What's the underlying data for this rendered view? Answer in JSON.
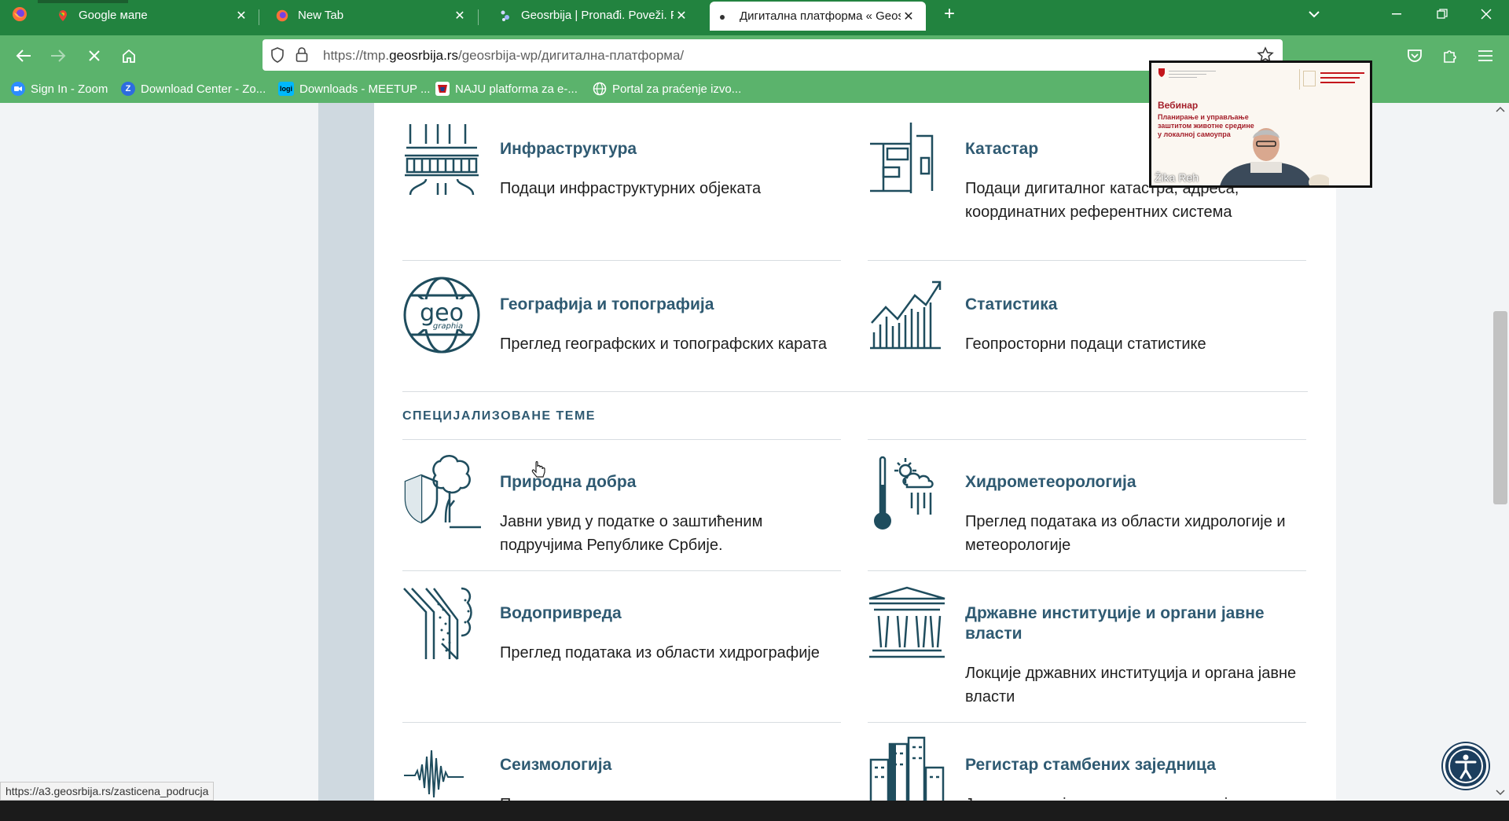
{
  "browser": {
    "tabs": [
      {
        "title": "Google мапе",
        "icon": "maps-pin-icon"
      },
      {
        "title": "New Tab",
        "icon": "firefox-icon"
      },
      {
        "title": "Geosrbija | Pronađi. Poveži. Prik",
        "icon": "geosrbija-icon"
      },
      {
        "title": "Дигитална платформа « Geosr",
        "icon": "dot-icon",
        "active": true
      }
    ],
    "url_prefix": "https://tmp.",
    "url_domain": "geosrbija.rs",
    "url_path": "/geosrbija-wp/дигитална-платформа/",
    "bookmarks": [
      {
        "label": "Sign In - Zoom",
        "icon": "zoom-icon"
      },
      {
        "label": "Download Center - Zo...",
        "icon": "zoom-z-icon"
      },
      {
        "label": "Downloads - MEETUP ...",
        "icon": "logi-icon"
      },
      {
        "label": "NAJU platforma za e-...",
        "icon": "naju-icon"
      },
      {
        "label": "Portal za praćenje izvo...",
        "icon": "globe-icon"
      }
    ]
  },
  "page": {
    "items": [
      {
        "title": "Инфраструктура",
        "desc": "Подаци инфраструктурних објеката"
      },
      {
        "title": "Катастар",
        "desc": "Подаци дигиталног катастра, адреса, координатних референтних система"
      },
      {
        "title": "Географија и топографија",
        "desc": "Преглед географских и топографских карата"
      },
      {
        "title": "Статистика",
        "desc": "Геопросторни подаци статистике"
      },
      {
        "title": "Природна добра",
        "desc": "Јавни увид у податке о заштићеним подручјима Републике Србије."
      },
      {
        "title": "Хидрометеорологија",
        "desc": "Преглед података из области хидрологије и метеорологије"
      },
      {
        "title": "Водопривреда",
        "desc": "Преглед података из области хидрографије"
      },
      {
        "title": "Државне институције и органи јавне власти",
        "desc": "Локције државних институција и органа јавне власти"
      },
      {
        "title": "Сеизмологија",
        "desc": "Подаци сеизмичких хазарда,"
      },
      {
        "title": "Регистар стамбених заједница",
        "desc": "Јавни увид у јединствену евиденцију"
      }
    ],
    "section_heading": "СПЕЦИЈАЛИЗОВАНЕ ТЕМЕ",
    "geo_logo": {
      "word": "geo",
      "sub": "graphia"
    }
  },
  "status_url": "https://a3.geosrbija.rs/zasticena_podrucja",
  "zoom_overlay": {
    "participant": "Žika Reh",
    "slide_title": "Вебинар",
    "slide_subtitle": "Планирање и управљање заштитом животне средине у локалној самоупра"
  },
  "colors": {
    "chrome": "#22833f",
    "toolbar": "#5bb36c",
    "heading": "#2f5a72",
    "icon": "#1f4d5e"
  }
}
